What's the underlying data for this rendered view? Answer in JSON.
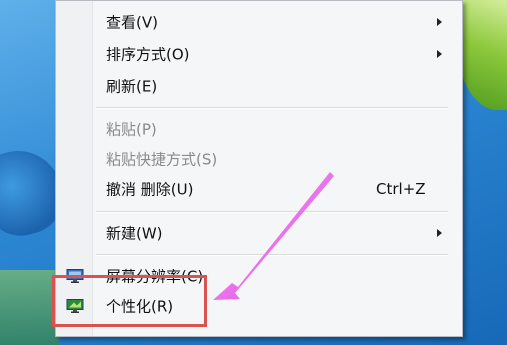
{
  "context_menu": {
    "items": [
      {
        "label": "查看(V)",
        "submenu": true,
        "disabled": false
      },
      {
        "label": "排序方式(O)",
        "submenu": true,
        "disabled": false
      },
      {
        "label": "刷新(E)",
        "submenu": false,
        "disabled": false
      },
      {
        "label": "粘贴(P)",
        "submenu": false,
        "disabled": true
      },
      {
        "label": "粘贴快捷方式(S)",
        "submenu": false,
        "disabled": true
      },
      {
        "label": "撤消 删除(U)",
        "shortcut": "Ctrl+Z",
        "submenu": false,
        "disabled": false
      },
      {
        "label": "新建(W)",
        "submenu": true,
        "disabled": false
      },
      {
        "label": "屏幕分辨率(C)",
        "icon": "monitor-icon",
        "submenu": false,
        "disabled": false
      },
      {
        "label": "个性化(R)",
        "icon": "personalize-icon",
        "submenu": false,
        "disabled": false
      }
    ]
  },
  "annotation": {
    "highlight_color": "#d9534f",
    "arrow_color": "#e040e0"
  }
}
